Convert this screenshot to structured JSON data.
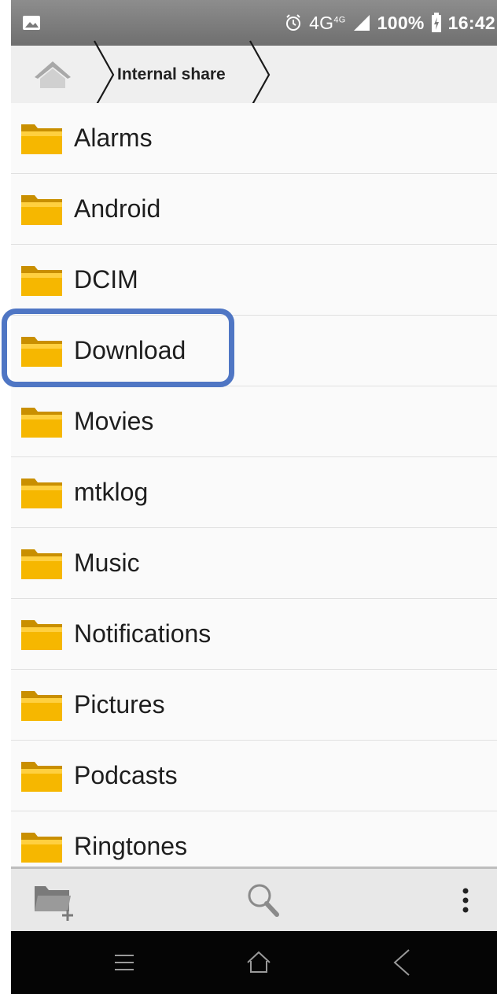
{
  "status_bar": {
    "net_type": "4G",
    "net_super": "4G",
    "battery": "100%",
    "time": "16:42",
    "icons": [
      "gallery-icon",
      "alarm-icon",
      "signal-icon",
      "battery-charging-icon"
    ]
  },
  "breadcrumb": {
    "home_icon": "home-icon",
    "current": "Internal share"
  },
  "folders": [
    {
      "label": "Alarms"
    },
    {
      "label": "Android"
    },
    {
      "label": "DCIM"
    },
    {
      "label": "Download"
    },
    {
      "label": "Movies"
    },
    {
      "label": "mtklog"
    },
    {
      "label": "Music"
    },
    {
      "label": "Notifications"
    },
    {
      "label": "Pictures"
    },
    {
      "label": "Podcasts"
    },
    {
      "label": "Ringtones"
    }
  ],
  "highlighted_folder": "Download",
  "toolbar": {
    "buttons": [
      "new-folder-icon",
      "search-icon",
      "more-vert-icon"
    ]
  },
  "navbar": {
    "buttons": [
      "menu-icon",
      "home-icon",
      "back-icon"
    ]
  },
  "colors": {
    "accent_highlight": "#4f76c4",
    "folder_fill": "#f6b700",
    "statusbar_bg": "#7d7d7d",
    "navbar_bg": "#050505"
  }
}
